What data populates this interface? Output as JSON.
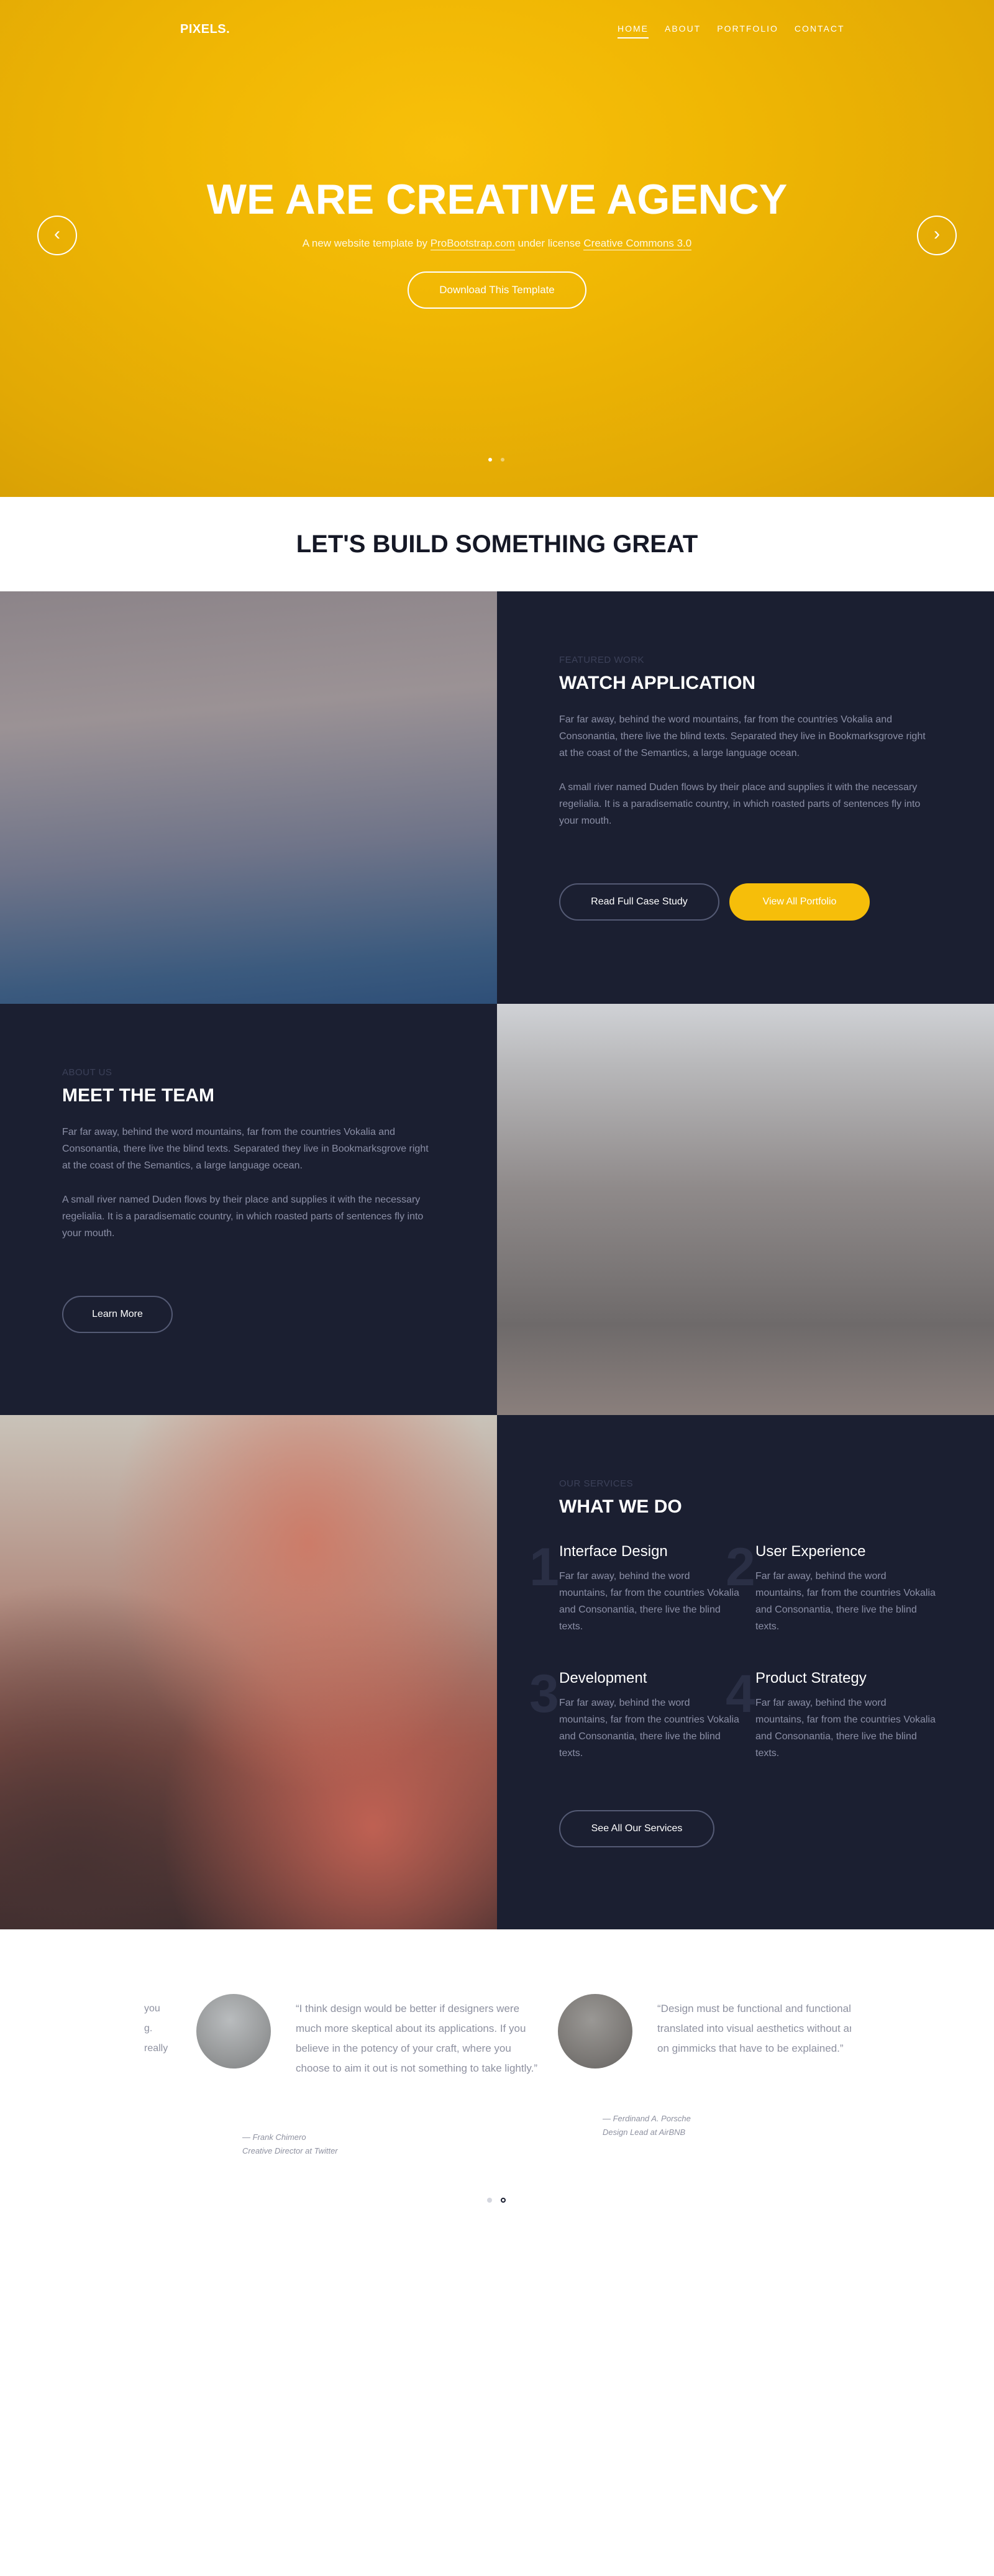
{
  "nav": {
    "logo": "PIXELS.",
    "items": [
      "HOME",
      "ABOUT",
      "PORTFOLIO",
      "CONTACT"
    ],
    "active_index": 0
  },
  "hero": {
    "title": "WE ARE CREATIVE AGENCY",
    "subtitle_prefix": "A new website template by ",
    "subtitle_link": "ProBootstrap.com",
    "subtitle_middle": " under license ",
    "subtitle_license": "Creative Commons 3.0",
    "cta": "Download This Template",
    "prev_icon": "chevron-left-icon",
    "next_icon": "chevron-right-icon",
    "slides": 2,
    "active_slide": 1,
    "colors": {
      "bg": "#f0b704"
    }
  },
  "headline": "LET'S BUILD SOMETHING GREAT",
  "featured": {
    "kicker": "FEATURED WORK",
    "title": "WATCH APPLICATION",
    "para1": "Far far away, behind the word mountains, far from the countries Vokalia and Consonantia, there live the blind texts. Separated they live in Bookmarksgrove right at the coast of the Semantics, a large language ocean.",
    "para2": "A small river named Duden flows by their place and supplies it with the necessary regelialia. It is a paradisematic country, in which roasted parts of sentences fly into your mouth.",
    "btn_case": "Read Full Case Study",
    "btn_portfolio": "View All Portfolio"
  },
  "team": {
    "kicker": "ABOUT US",
    "title": "MEET THE TEAM",
    "para1": "Far far away, behind the word mountains, far from the countries Vokalia and Consonantia, there live the blind texts. Separated they live in Bookmarksgrove right at the coast of the Semantics, a large language ocean.",
    "para2": "A small river named Duden flows by their place and supplies it with the necessary regelialia. It is a paradisematic country, in which roasted parts of sentences fly into your mouth.",
    "btn": "Learn More"
  },
  "services": {
    "kicker": "OUR SERVICES",
    "title": "WHAT WE DO",
    "items": [
      {
        "num": "1",
        "title": "Interface Design",
        "text": "Far far away, behind the word mountains, far from the countries Vokalia and Consonantia, there live the blind texts."
      },
      {
        "num": "2",
        "title": "User Experience",
        "text": "Far far away, behind the word mountains, far from the countries Vokalia and Consonantia, there live the blind texts."
      },
      {
        "num": "3",
        "title": "Development",
        "text": "Far far away, behind the word mountains, far from the countries Vokalia and Consonantia, there live the blind texts."
      },
      {
        "num": "4",
        "title": "Product Strategy",
        "text": "Far far away, behind the word mountains, far from the countries Vokalia and Consonantia, there live the blind texts."
      }
    ],
    "btn": "See All Our Services"
  },
  "testimonials": {
    "left_fragment": [
      "you",
      "g.",
      "really"
    ],
    "items": [
      {
        "quote": "“I think design would be better if designers were much more skeptical about its applications. If you believe in the potency of your craft, where you choose to aim it out is not something to take lightly.”",
        "author": "— Frank Chimero",
        "role": "Creative Director at Twitter"
      },
      {
        "quote": "“Design must be functional and functionality must be translated into visual aesthetics without any reliance on gimmicks that have to be explained.”",
        "author": "— Ferdinand A. Porsche",
        "role": "Design Lead at AirBNB"
      }
    ],
    "pages": 2,
    "active_page": 2
  }
}
